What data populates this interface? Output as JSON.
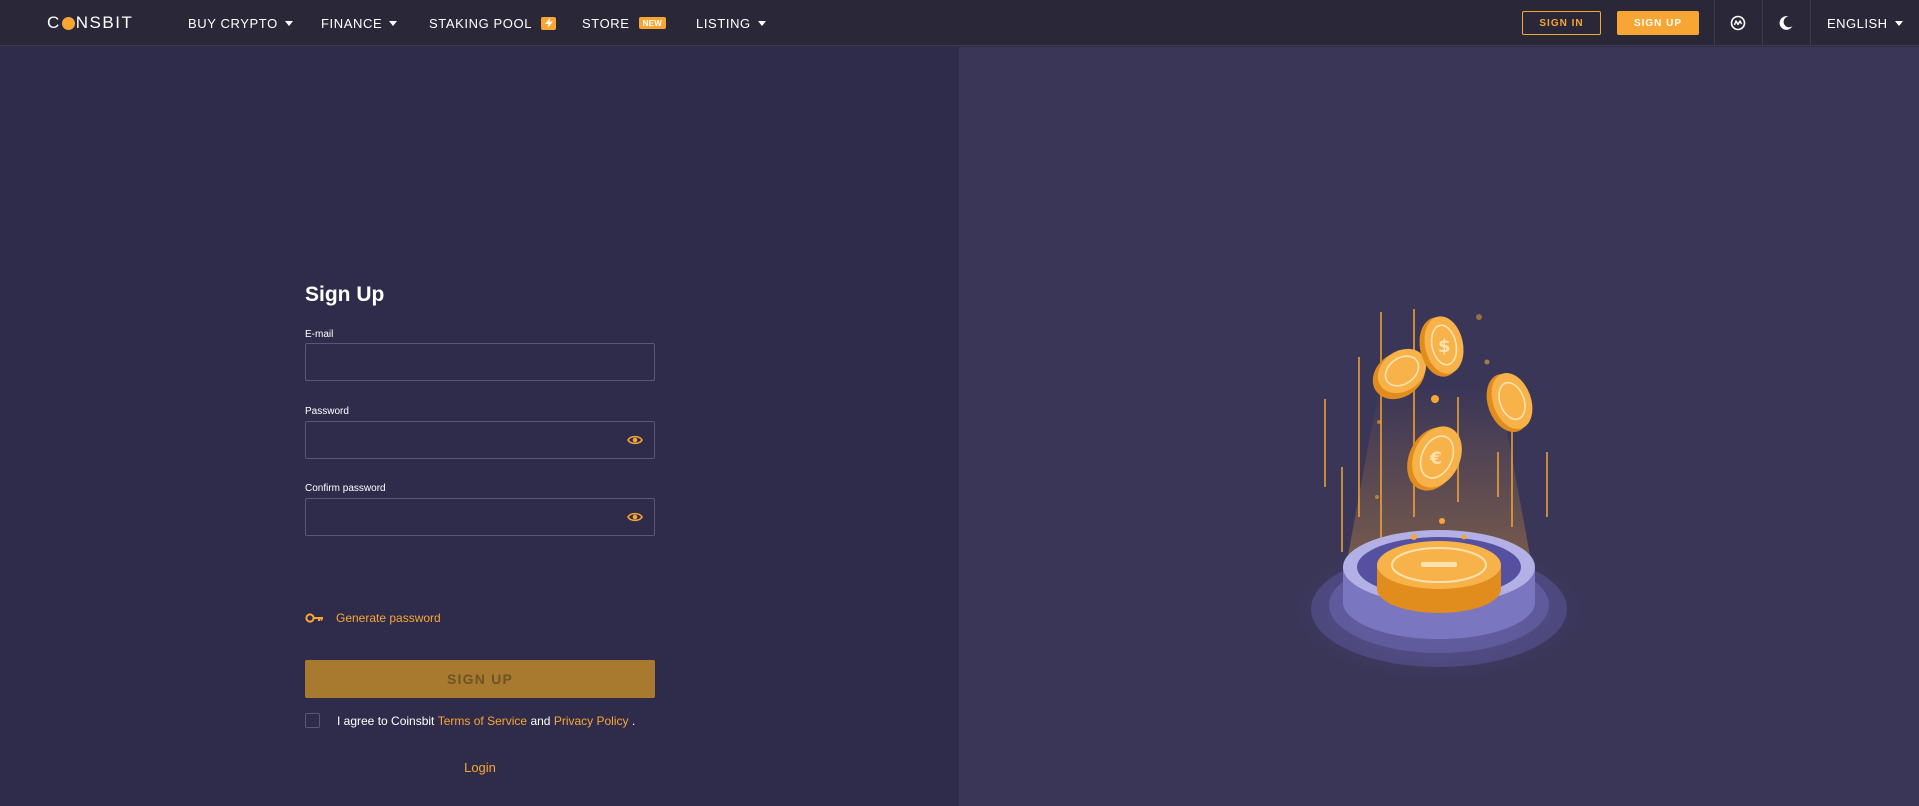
{
  "header": {
    "logo": {
      "pre": "C",
      "post": "NSBIT"
    },
    "nav": [
      {
        "label": "BUY CRYPTO",
        "has_caret": true
      },
      {
        "label": "FINANCE",
        "has_caret": true
      },
      {
        "label": "STAKING POOL",
        "badge_icon": "bolt-icon"
      },
      {
        "label": "STORE",
        "badge_text": "NEW"
      },
      {
        "label": "LISTING",
        "has_caret": true
      }
    ],
    "sign_in_label": "SIGN IN",
    "sign_up_label": "SIGN UP",
    "icons": [
      "coinmarketcap-icon",
      "moon-icon"
    ],
    "language": "ENGLISH"
  },
  "form": {
    "title": "Sign Up",
    "email_label": "E-mail",
    "email_value": "",
    "password_label": "Password",
    "password_value": "",
    "confirm_label": "Confirm password",
    "confirm_value": "",
    "generate_password": "Generate password",
    "submit_label": "SIGN UP",
    "agree_prefix": "I agree to Coinsbit",
    "terms_link": "Terms of Service",
    "and_text": "and",
    "privacy_link": "Privacy Policy",
    "period": ".",
    "login_link": "Login"
  },
  "colors": {
    "accent": "#f7a634",
    "header_bg": "#2a2838",
    "left_bg": "#2f2c4b",
    "right_bg": "#3a3658",
    "submit_disabled": "#a87a30"
  }
}
